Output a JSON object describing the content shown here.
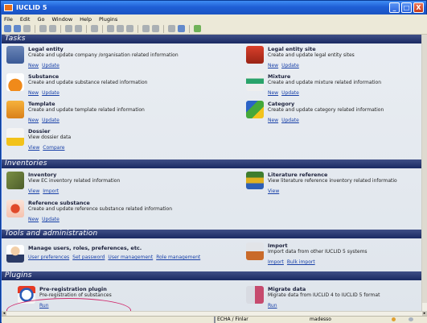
{
  "window": {
    "title": "IUCLID 5",
    "buttons": {
      "minimize": "_",
      "maximize": "□",
      "close": "X"
    }
  },
  "menu": [
    "File",
    "Edit",
    "Go",
    "Window",
    "Help",
    "Plugins"
  ],
  "sections": {
    "tasks": "Tasks",
    "inventories": "Inventories",
    "tools": "Tools and administration",
    "plugins": "Plugins"
  },
  "items": {
    "legal_entity": {
      "title": "Legal entity",
      "desc": "Create and update company /organisation related information",
      "links": [
        "New",
        "Update"
      ]
    },
    "legal_entity_site": {
      "title": "Legal entity site",
      "desc": "Create and update legal entity sites",
      "links": [
        "New",
        "Update"
      ]
    },
    "substance": {
      "title": "Substance",
      "desc": "Create and update substance related information",
      "links": [
        "New",
        "Update"
      ]
    },
    "mixture": {
      "title": "Mixture",
      "desc": "Create and update mixture related information",
      "links": [
        "New",
        "Update"
      ]
    },
    "template": {
      "title": "Template",
      "desc": "Create and update template related information",
      "links": [
        "New",
        "Update"
      ]
    },
    "category": {
      "title": "Category",
      "desc": "Create and update category related information",
      "links": [
        "New",
        "Update"
      ]
    },
    "dossier": {
      "title": "Dossier",
      "desc": "View dossier data",
      "links": [
        "View",
        "Compare"
      ]
    },
    "inventory": {
      "title": "Inventory",
      "desc": "View EC inventory related information",
      "links": [
        "View",
        "Import"
      ]
    },
    "literature": {
      "title": "Literature reference",
      "desc": "View literature reference inventory related informatio",
      "links": [
        "View"
      ]
    },
    "reference_substance": {
      "title": "Reference substance",
      "desc": "Create and update reference substance related information",
      "links": [
        "New",
        "Update"
      ]
    },
    "manage_users": {
      "title": "Manage users, roles, preferences, etc.",
      "desc": "",
      "links": [
        "User preferences",
        "Set password",
        "User management",
        "Role management"
      ]
    },
    "import": {
      "title": "Import",
      "desc": "Import data from other IUCLID 5 systems",
      "links": [
        "Import",
        "Bulk import"
      ]
    },
    "preregistration": {
      "title": "Pre-registration plugin",
      "desc": "Pre-registration of substances",
      "links": [
        "Run"
      ]
    },
    "migrate": {
      "title": "Migrate data",
      "desc": "Migrate data from IUCLID 4 to IUCLID 5 format",
      "links": [
        "Run"
      ]
    }
  },
  "status": {
    "db": "ECHA / Finlar",
    "user": "madesso"
  }
}
